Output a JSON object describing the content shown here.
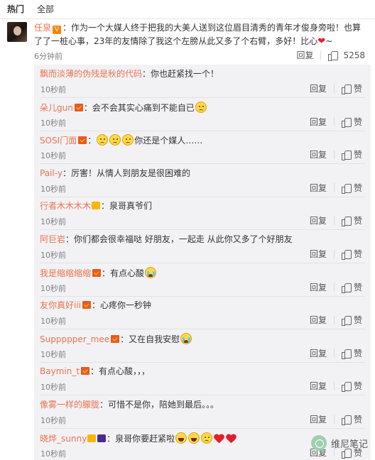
{
  "tabs": {
    "hot": "热门",
    "all": "全部"
  },
  "main_comment": {
    "username": "任泉",
    "text": "：作为一个大媒人终于把我的大美人送到这位眉目清秀的青年才俊身旁啦！也算了了一桩心事，23年的友情除了我这个左膀从此又多了个右臂，多好！比心",
    "trail": "~",
    "time": "6分钟前",
    "reply_label": "回复",
    "like_count": "5258"
  },
  "replies": [
    {
      "username": "飘而淡薄的伪残是秋的代码",
      "badges": [],
      "text": "：你也赶紧找一个！",
      "time": "10秒前",
      "reply_label": "回复",
      "like_label": "赞"
    },
    {
      "username": "朵儿gun",
      "badges": [
        "vip"
      ],
      "text": "：会不会其实心痛到不能自已",
      "emojis_after": [
        "sad"
      ],
      "time": "10秒前",
      "reply_label": "回复",
      "like_label": "赞"
    },
    {
      "username": "SOSI门面",
      "badges": [
        "vip"
      ],
      "text_prefix": "：",
      "emojis_before": [
        "sad",
        "sad",
        "sad"
      ],
      "text": "你还是个媒人……",
      "time": "10秒前",
      "reply_label": "回复",
      "like_label": "赞"
    },
    {
      "username": "Pail-y",
      "badges": [],
      "text": "：厉害！从情人到朋友是很困难的",
      "time": "10秒前",
      "reply_label": "回复",
      "like_label": "赞"
    },
    {
      "username": "行者木木木木",
      "badges": [
        "fan"
      ],
      "text": "：泉哥真爷们",
      "time": "10秒前",
      "reply_label": "回复",
      "like_label": "赞"
    },
    {
      "username": "阿巨岩",
      "badges": [],
      "text": "：你们都会很幸福哒 好朋友，一起走 从此你又多了个好朋友",
      "time": "10秒前",
      "reply_label": "回复",
      "like_label": "赞"
    },
    {
      "username": "我是缩缩缩缩",
      "badges": [
        "vip"
      ],
      "text": "：有点心酸",
      "emojis_after": [
        "cry"
      ],
      "time": "10秒前",
      "reply_label": "回复",
      "like_label": "赞"
    },
    {
      "username": "友你真好iii",
      "badges": [
        "vip"
      ],
      "text": "：心疼你一秒钟",
      "time": "10秒前",
      "reply_label": "回复",
      "like_label": "赞"
    },
    {
      "username": "Suppppper_mee",
      "badges": [
        "vip"
      ],
      "text": "：又在自我安慰",
      "emojis_after": [
        "cry"
      ],
      "time": "10秒前",
      "reply_label": "回复",
      "like_label": "赞"
    },
    {
      "username": "Baymin_t",
      "badges": [
        "vip"
      ],
      "text": "：有点心酸，，，",
      "time": "10秒前",
      "reply_label": "回复",
      "like_label": "赞"
    },
    {
      "username": "像雾一样的朦胧",
      "badges": [],
      "text": "：可惜不是你，陪她到最后。。。",
      "time": "10秒前",
      "reply_label": "回复",
      "like_label": "赞"
    },
    {
      "username": "晓烨_sunny",
      "badges": [
        "fan",
        "purple"
      ],
      "text": "：泉哥你要赶紧啦",
      "emojis_after": [
        "laugh",
        "laugh",
        "sad",
        "heart",
        "heart"
      ],
      "time": "10秒前",
      "reply_label": "回复",
      "like_label": "赞"
    }
  ],
  "watermark": {
    "text": "维尼笔记"
  }
}
